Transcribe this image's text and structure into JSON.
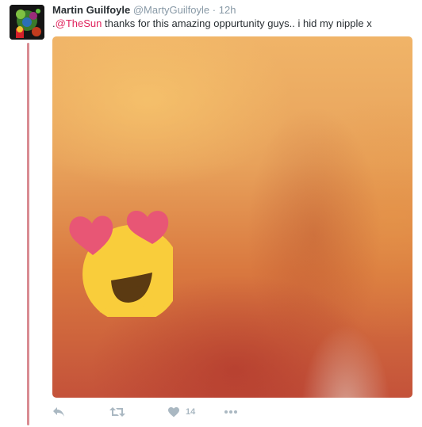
{
  "tweet": {
    "author_name": "Martin Guilfoyle",
    "author_handle": "@MartyGuilfoyle",
    "separator": "·",
    "time": "12h",
    "text_prefix": ".",
    "mention": "@TheSun",
    "text_body": " thanks for this amazing oppurtunity guys.. i hid my nipple x",
    "like_count": "14"
  },
  "colors": {
    "mention": "#e0245e",
    "thread_line": "#d98c92",
    "action_icons": "#aab8c2",
    "meta_text": "#8899a6"
  },
  "icons": {
    "reply": "reply-icon",
    "retweet": "retweet-icon",
    "like": "heart-icon",
    "more": "more-icon",
    "media_emoji": "heart-eyes-emoji"
  }
}
